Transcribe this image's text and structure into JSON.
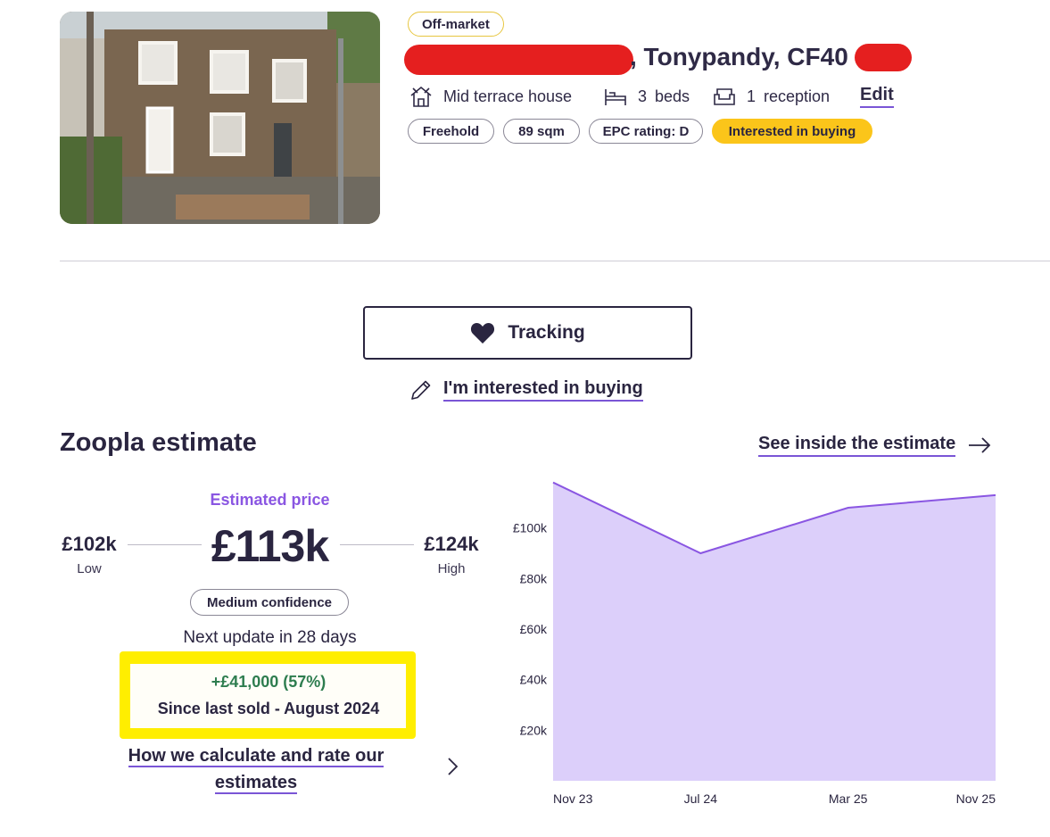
{
  "property": {
    "status_badge": "Off-market",
    "address_visible": ", Tonypandy, CF40",
    "type": "Mid terrace house",
    "beds_count": "3",
    "beds_label": "beds",
    "reception_count": "1",
    "reception_label": "reception",
    "edit_label": "Edit",
    "tags": [
      "Freehold",
      "89 sqm",
      "EPC rating: D",
      "Interested in buying"
    ]
  },
  "actions": {
    "tracking_label": "Tracking",
    "interested_label": "I'm interested in buying"
  },
  "estimate": {
    "heading": "Zoopla estimate",
    "see_inside_label": "See inside the estimate",
    "estimated_price_label": "Estimated price",
    "price": "£113k",
    "low_value": "£102k",
    "low_label": "Low",
    "high_value": "£124k",
    "high_label": "High",
    "confidence": "Medium confidence",
    "next_update": "Next update in 28 days",
    "change": "+£41,000 (57%)",
    "since": "Since last sold - August 2024",
    "how_line1": "How we calculate and rate our",
    "how_line2": "estimates"
  },
  "chart_data": {
    "type": "area",
    "x": [
      "Nov 23",
      "Jul 24",
      "Mar 25",
      "Nov 25"
    ],
    "y": [
      118000,
      90000,
      108000,
      113000
    ],
    "y_ticks": [
      "£20k",
      "£40k",
      "£60k",
      "£80k",
      "£100k"
    ],
    "ylim": [
      0,
      120000
    ],
    "fill_color": "#dccffa",
    "line_color": "#8a56e2"
  },
  "colors": {
    "accent_purple": "#7a55d6",
    "highlight_yellow": "#ffee00",
    "interest_tag": "#fbc51a",
    "positive_green": "#2e7d4f"
  }
}
